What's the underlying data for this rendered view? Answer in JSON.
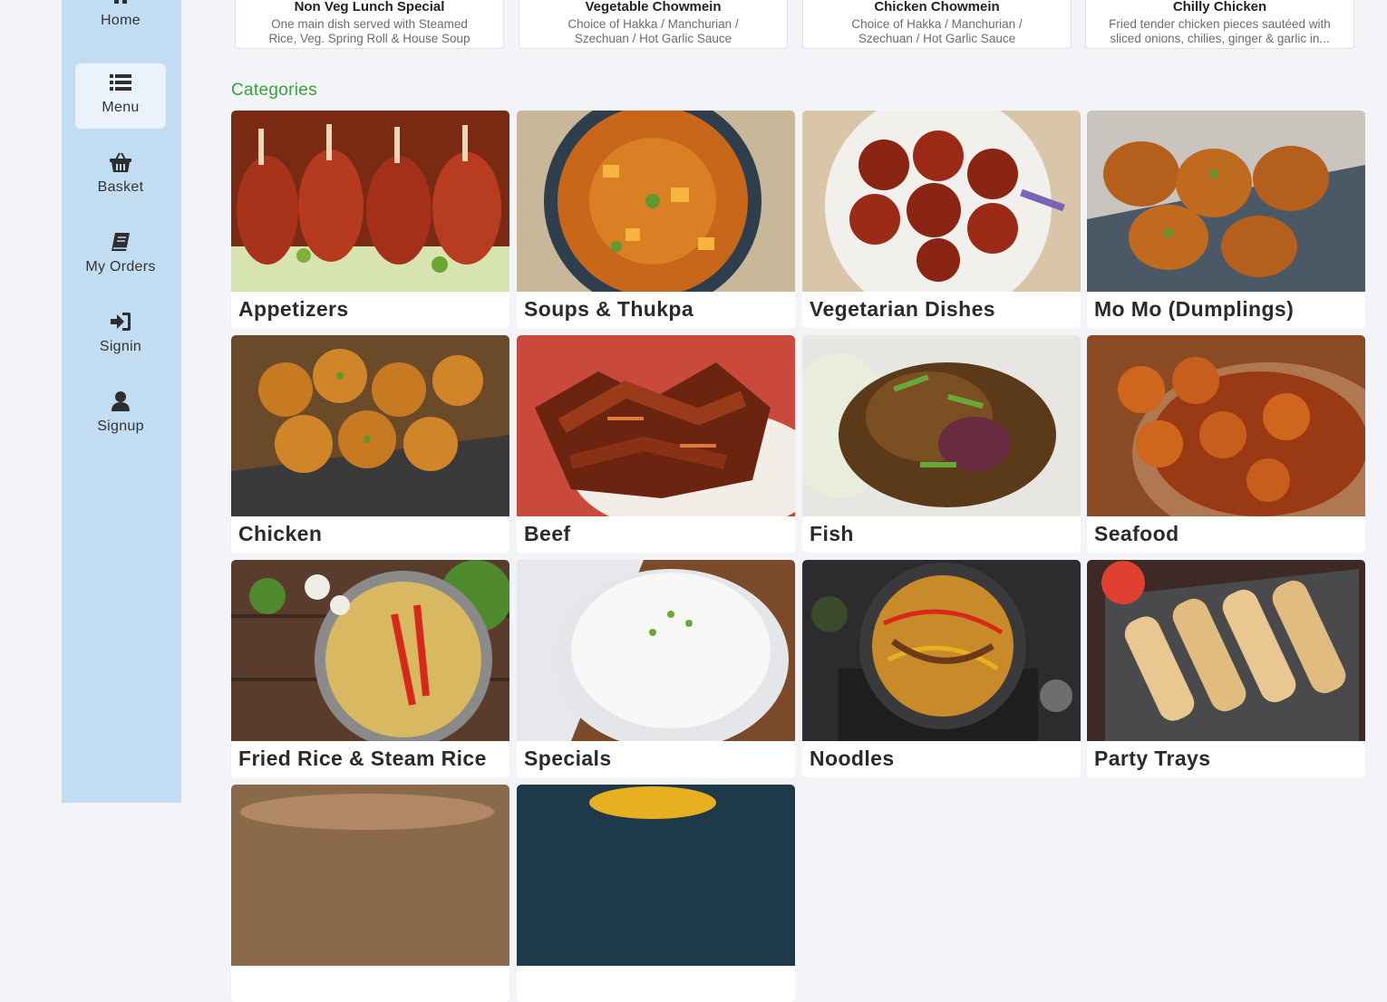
{
  "sidebar": {
    "items": [
      {
        "label": "Home",
        "icon": "home-icon"
      },
      {
        "label": "Menu",
        "icon": "list-icon",
        "active": true
      },
      {
        "label": "Basket",
        "icon": "basket-icon"
      },
      {
        "label": "My Orders",
        "icon": "book-icon"
      },
      {
        "label": "Signin",
        "icon": "sign-in-icon"
      },
      {
        "label": "Signup",
        "icon": "user-icon"
      }
    ],
    "background": "#c2dcf1",
    "active_background": "#eaf3fb"
  },
  "specials": [
    {
      "title": "Non Veg Lunch Special",
      "description": "One main dish served with Steamed Rice, Veg. Spring Roll & House Soup"
    },
    {
      "title": "Vegetable Chowmein",
      "description": "Choice of Hakka / Manchurian / Szechuan / Hot Garlic Sauce"
    },
    {
      "title": "Chicken Chowmein",
      "description": "Choice of Hakka / Manchurian / Szechuan / Hot Garlic Sauce"
    },
    {
      "title": "Chilly Chicken",
      "description": "Fried tender chicken pieces sautéed with sliced onions, chilies, ginger & garlic in..."
    }
  ],
  "categories": {
    "heading": "Categories",
    "heading_color": "#3aa13a",
    "items": [
      {
        "name": "Appetizers"
      },
      {
        "name": "Soups & Thukpa"
      },
      {
        "name": "Vegetarian Dishes"
      },
      {
        "name": "Mo Mo (Dumplings)"
      },
      {
        "name": "Chicken"
      },
      {
        "name": "Beef"
      },
      {
        "name": "Fish"
      },
      {
        "name": "Seafood"
      },
      {
        "name": "Fried Rice & Steam Rice"
      },
      {
        "name": "Specials"
      },
      {
        "name": "Noodles"
      },
      {
        "name": "Party Trays"
      }
    ]
  }
}
